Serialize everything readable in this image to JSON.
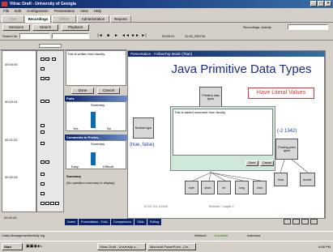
{
  "window": {
    "title": "Vitrac Draft - University of Georgia"
  },
  "menu": [
    "File",
    "Edit",
    "Configuration",
    "Presentation",
    "View",
    "Help"
  ],
  "tabs": [
    {
      "label": "Live"
    },
    {
      "label": "Recordings"
    },
    {
      "label": "Offline"
    },
    {
      "label": "Administration"
    },
    {
      "label": "Reports"
    }
  ],
  "toolbar": {
    "sessions_label": "Sessions",
    "search_label": "Search",
    "playback_label": "Playback",
    "recordings_label": "Recordings: Activity",
    "search_for_label": "Search for"
  },
  "player": {
    "time": "00:00:01",
    "total": "11:05_030734"
  },
  "timeline_times": [
    "00:00:00",
    "00:10:41",
    "00:21:22",
    "00:32:03",
    "00:42:44"
  ],
  "comment_panel": {
    "text": "This is written from faculty",
    "done": "Done",
    "cancel": "Cancel"
  },
  "poll_panel": {
    "title": "Polls",
    "q": "Summary",
    "labels": [
      "Yes",
      "No"
    ]
  },
  "poll_panel2": {
    "title": "Comments to Profes...",
    "q": "Summary",
    "labels": [
      "Easy",
      "Difficult"
    ]
  },
  "summary_panel": {
    "title": "Summary",
    "text": "(No question summary to display)"
  },
  "presentation": {
    "title": "Presentation - FollowTop Mode (Titan)",
    "slide_title": "Java Primitive Data Types",
    "subtitle": "Have Literal Values",
    "root_node": "Primitive data types",
    "boolean_node": "Boolean type",
    "boolean_vals": "(true, false)",
    "number_vals": "(-2 1342)",
    "float_node": "Floating-point types",
    "leaves": [
      "byte",
      "short",
      "int",
      "long",
      "char"
    ],
    "float_leaves": [
      "float",
      "double"
    ],
    "comment_text": "This is added comment from faculty",
    "done": "Done",
    "cancel": "Cancel",
    "footer_left": "ECCE 114 1/24/08",
    "footer_mid": "Ricketts / Chapter 2"
  },
  "bottom_tabs": [
    "Notes",
    "Presentation - Follo",
    "Comparisons",
    "Slide",
    "Polling"
  ],
  "status": {
    "left": "Class Management",
    "mid": "Activity log",
    "network": "Network",
    "sync": "Excellent",
    "user": "Instructor",
    "clock": "6:56 PM"
  },
  "taskbar": {
    "start": "Start",
    "items": [
      "Vitrac Draft - University o...",
      "Microsoft PowerPoint - [Ja..."
    ]
  }
}
